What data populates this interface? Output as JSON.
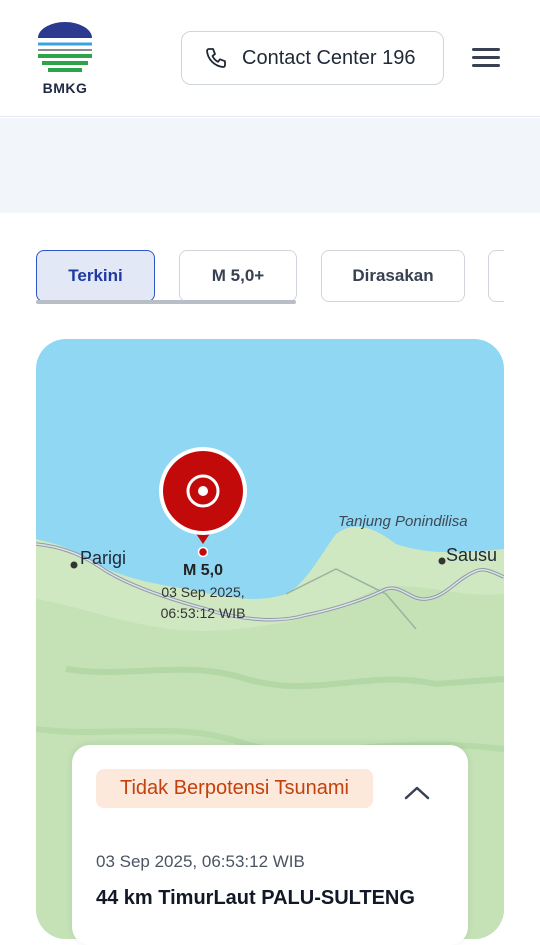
{
  "header": {
    "logo_text": "BMKG",
    "contact_label": "Contact Center 196",
    "phone_icon": "phone-icon",
    "menu_icon": "hamburger-menu-icon"
  },
  "tabs": [
    {
      "label": "Terkini",
      "active": true
    },
    {
      "label": "M 5,0+",
      "active": false
    },
    {
      "label": "Dirasakan",
      "active": false
    },
    {
      "label": "",
      "active": false
    }
  ],
  "map": {
    "places": {
      "parigi": "Parigi",
      "sausu": "Sausu",
      "tanjung": "Tanjung Ponindilisa"
    },
    "epicenter": {
      "magnitude": "M 5,0",
      "date": "03 Sep 2025,",
      "time": "06:53:12 WIB"
    },
    "colors": {
      "sea": "#8fd7f2",
      "land": "#cfe8c2",
      "accent": "#c20a0a"
    }
  },
  "info": {
    "tsunami_status": "Tidak Berpotensi Tsunami",
    "datetime": "03 Sep 2025, 06:53:12 WIB",
    "location": "44 km TimurLaut PALU-SULTENG",
    "collapse_icon": "chevron-up-icon"
  }
}
